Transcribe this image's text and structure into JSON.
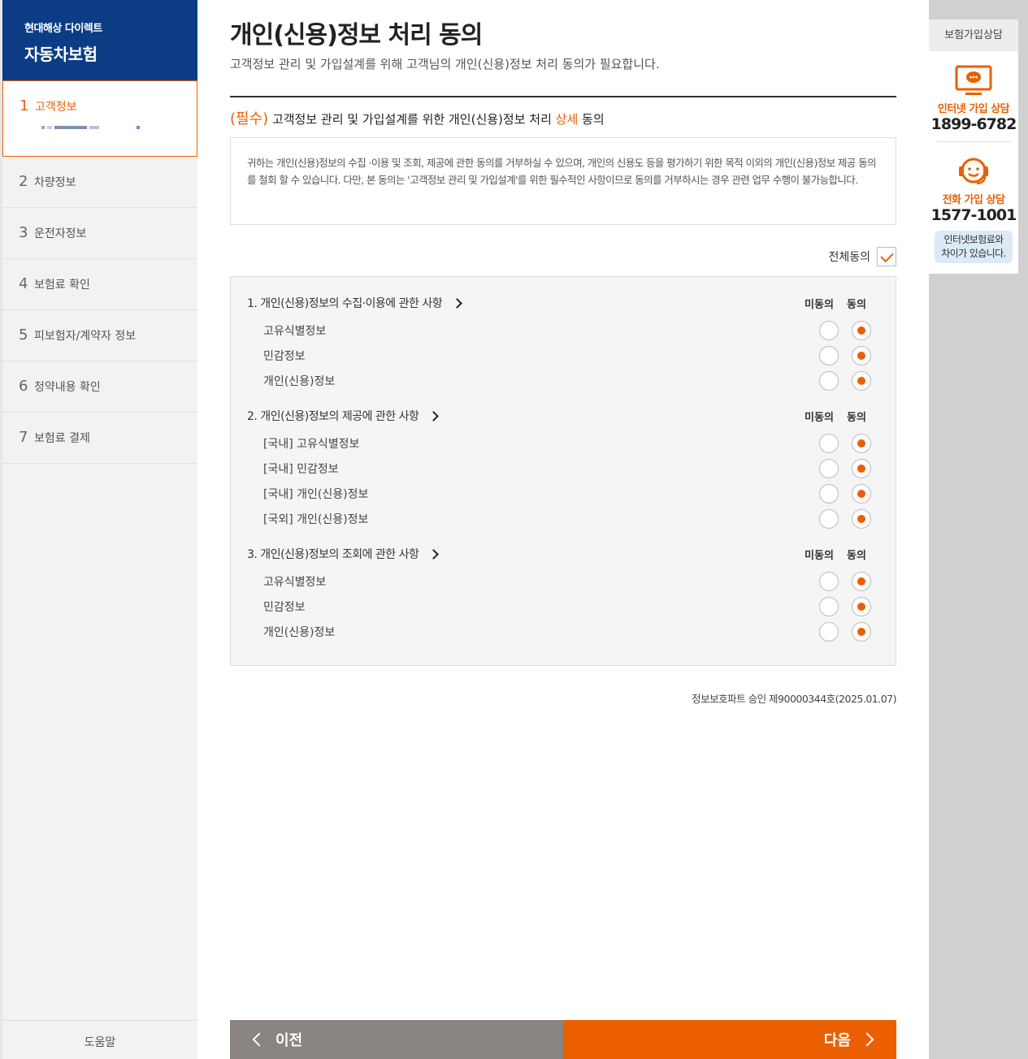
{
  "brand": {
    "company": "현대해상 다이렉트",
    "product": "자동차보험"
  },
  "steps": [
    {
      "num": "1",
      "label": "고객정보"
    },
    {
      "num": "2",
      "label": "차량정보"
    },
    {
      "num": "3",
      "label": "운전자정보"
    },
    {
      "num": "4",
      "label": "보험료 확인"
    },
    {
      "num": "5",
      "label": "피보험자/계약자 정보"
    },
    {
      "num": "6",
      "label": "청약내용 확인"
    },
    {
      "num": "7",
      "label": "보험료 결제"
    }
  ],
  "help_label": "도움말",
  "page": {
    "title": "개인(신용)정보 처리 동의",
    "subtitle": "고객정보 관리 및 가입설계를 위해 고객님의 개인(신용)정보 처리 동의가 필요합니다.",
    "req_tag": "(필수)",
    "req_text1": "고객정보 관리 및 가입설계를 위한 개인(신용)정보 처리",
    "req_detail": "상세",
    "req_text2": "동의",
    "notice": "귀하는 개인(신용)정보의 수집 ·이용 및 조회, 제공에 관한 동의를 거부하실 수 있으며, 개인의 신용도 등을 평가하기 위한 목적 이외의 개인(신용)정보 제공 동의를 철회 할 수 있습니다. 다만, 본 동의는 '고객정보 관리 및 가입설계'를 위한 필수적인 사항이므로 동의를 거부하시는 경우 관련 업무 수행이 불가능합니다.",
    "agree_all": "전체동의",
    "col_disagree": "미동의",
    "col_agree": "동의",
    "sections": [
      {
        "title": "1. 개인(신용)정보의 수집·이용에 관한 사항",
        "items": [
          "고유식별정보",
          "민감정보",
          "개인(신용)정보"
        ]
      },
      {
        "title": "2. 개인(신용)정보의 제공에 관한 사항",
        "items": [
          "[국내] 고유식별정보",
          "[국내] 민감정보",
          "[국내] 개인(신용)정보",
          "[국외] 개인(신용)정보"
        ]
      },
      {
        "title": "3. 개인(신용)정보의 조회에 관한 사항",
        "items": [
          "고유식별정보",
          "민감정보",
          "개인(신용)정보"
        ]
      }
    ],
    "approval": "정보보호파트 승인 제90000344호(2025.01.07)",
    "prev_label": "이전",
    "next_label": "다음"
  },
  "consult": {
    "header": "보험가입상담",
    "internet_label": "인터넷 가입 상담",
    "internet_number": "1899-6782",
    "phone_label": "전화 가입 상담",
    "phone_number": "1577-1001",
    "note_line1": "인터넷보험료와",
    "note_line2": "차이가 있습니다."
  },
  "colors": {
    "accent": "#eb5f00",
    "brand": "#0b3c84",
    "prev_button": "#8a8580"
  }
}
